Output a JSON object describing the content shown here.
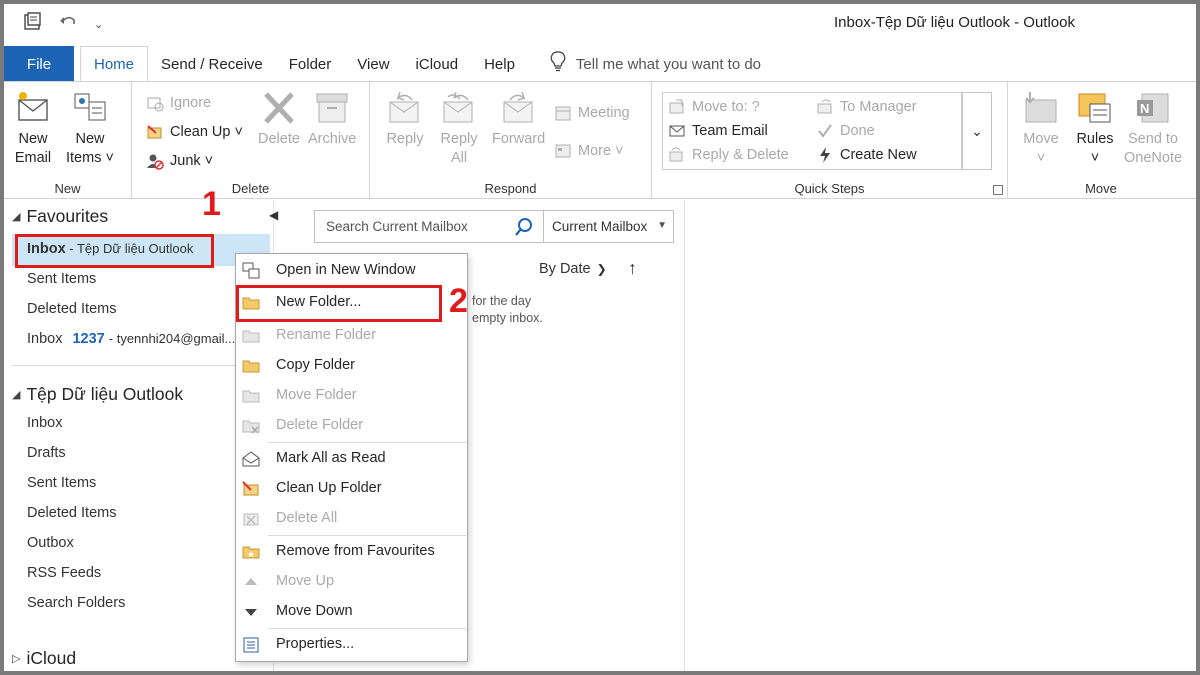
{
  "window": {
    "title": "Inbox-Tệp Dữ liệu Outlook  -  Outlook"
  },
  "tabs": [
    {
      "label": "File"
    },
    {
      "label": "Home"
    },
    {
      "label": "Send / Receive"
    },
    {
      "label": "Folder"
    },
    {
      "label": "View"
    },
    {
      "label": "iCloud"
    },
    {
      "label": "Help"
    }
  ],
  "tell_me": "Tell me what you want to do",
  "ribbon": {
    "new_group": {
      "label": "New",
      "new_email": [
        "New",
        "Email"
      ],
      "new_items": [
        "New",
        "Items ˅"
      ]
    },
    "delete_group": {
      "label": "Delete",
      "ignore": "Ignore",
      "clean_up": "Clean Up ˅",
      "junk": "Junk ˅",
      "delete": "Delete",
      "archive": "Archive"
    },
    "respond_group": {
      "label": "Respond",
      "reply": "Reply",
      "reply_all": [
        "Reply",
        "All"
      ],
      "forward": "Forward",
      "meeting": "Meeting",
      "more": "More ˅"
    },
    "quick_steps": {
      "label": "Quick Steps",
      "move_to": "Move to: ?",
      "team_email": "Team Email",
      "reply_delete": "Reply & Delete",
      "to_manager": "To Manager",
      "done": "Done",
      "create_new": "Create New"
    },
    "move_group": {
      "label": "Move",
      "move": [
        "Move",
        "˅"
      ],
      "rules": [
        "Rules",
        "˅"
      ],
      "onenote": [
        "Send to",
        "OneNote"
      ]
    }
  },
  "folder_pane": {
    "favourites": "Favourites",
    "fav_items": {
      "inbox_bold": "Inbox",
      "inbox_sub": " - Tệp Dữ liệu Outlook",
      "sent": "Sent Items",
      "deleted": "Deleted Items",
      "inbox2": "Inbox",
      "inbox2_count": "1237",
      "inbox2_sub": "tyennhi204@gmail..."
    },
    "data_file": "Tệp Dữ liệu Outlook",
    "data_items": [
      "Inbox",
      "Drafts",
      "Sent Items",
      "Deleted Items",
      "Outbox",
      "RSS Feeds",
      "Search Folders"
    ],
    "icloud": "iCloud"
  },
  "mail_list": {
    "search_placeholder": "Search Current Mailbox",
    "scope": "Current Mailbox",
    "sort": "By Date",
    "empty_line1": "for the day",
    "empty_line2": "empty inbox."
  },
  "context_menu": [
    {
      "label": "Open in New Window",
      "enabled": true
    },
    {
      "label": "New Folder...",
      "enabled": true
    },
    {
      "label": "Rename Folder",
      "enabled": false
    },
    {
      "label": "Copy Folder",
      "enabled": true
    },
    {
      "label": "Move Folder",
      "enabled": false
    },
    {
      "label": "Delete Folder",
      "enabled": false
    },
    {
      "label": "Mark All as Read",
      "enabled": true
    },
    {
      "label": "Clean Up Folder",
      "enabled": true
    },
    {
      "label": "Delete All",
      "enabled": false
    },
    {
      "label": "Remove from Favourites",
      "enabled": true
    },
    {
      "label": "Move Up",
      "enabled": false
    },
    {
      "label": "Move Down",
      "enabled": true
    },
    {
      "label": "Properties...",
      "enabled": true
    }
  ],
  "annotations": {
    "step1": "1",
    "step2": "2"
  },
  "colors": {
    "accent": "#1e64b4",
    "annotation": "#e11b1b",
    "selection": "#cde6f7"
  }
}
